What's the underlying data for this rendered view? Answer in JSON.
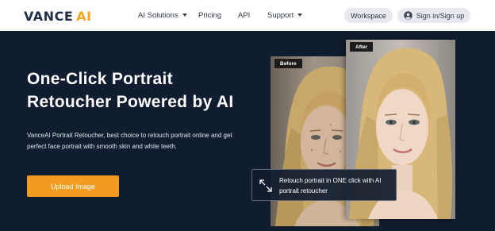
{
  "header": {
    "logo": {
      "primary": "VANCE",
      "accent": "AI"
    },
    "menu": [
      {
        "label": "AI Solutions",
        "has_dropdown": true
      },
      {
        "label": "Pricing",
        "has_dropdown": false
      },
      {
        "label": "API",
        "has_dropdown": false
      },
      {
        "label": "Support",
        "has_dropdown": true
      }
    ],
    "workspace_label": "Workspace",
    "signin_label": "Sign in/Sign up",
    "user_icon": "user-circle-icon"
  },
  "hero": {
    "title_line1": "One-Click Portrait",
    "title_line2": "Retoucher Powered by AI",
    "description": "VanceAI Portrait Retoucher, best choice to retouch portrait online and get perfect face portrait with smooth skin and white teeth.",
    "upload_label": "Upload Image",
    "before_label": "Before",
    "after_label": "After",
    "tooltip_text": "Retouch portrait in ONE click with AI portrait retoucher",
    "tooltip_icon": "expand-arrows-icon"
  },
  "colors": {
    "hero_background": "#101c2f",
    "accent_orange": "#f39a1f",
    "logo_ai": "#f5a623",
    "logo_text": "#223047",
    "nav_button_bg": "#e7e9ee"
  }
}
